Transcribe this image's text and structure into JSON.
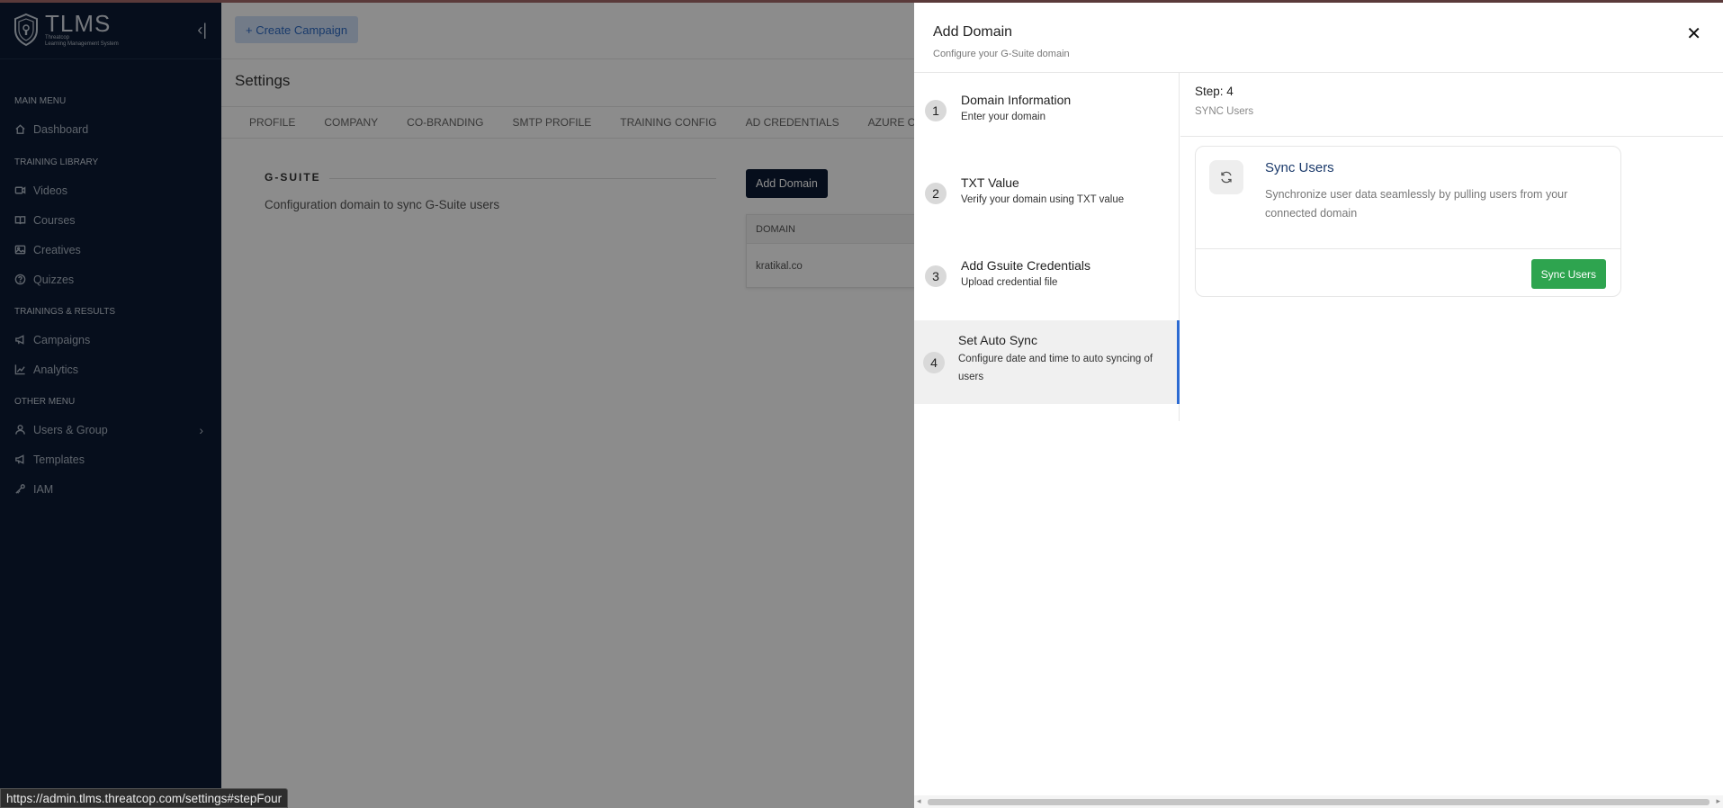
{
  "sidebar": {
    "brand_name": "TLMS",
    "brand_sub_1": "Threatcop",
    "brand_sub_2": "Learning Management System",
    "sections": {
      "main_menu": "MAIN MENU",
      "training_library": "TRAINING LIBRARY",
      "trainings_results": "TRAININGS & RESULTS",
      "other_menu": "OTHER MENU"
    },
    "items": {
      "dashboard": "Dashboard",
      "videos": "Videos",
      "courses": "Courses",
      "creatives": "Creatives",
      "quizzes": "Quizzes",
      "campaigns": "Campaigns",
      "analytics": "Analytics",
      "users_group": "Users & Group",
      "templates": "Templates",
      "iam": "IAM"
    }
  },
  "main": {
    "create_campaign": "+ Create Campaign",
    "page_title": "Settings",
    "tabs": [
      "PROFILE",
      "COMPANY",
      "CO-BRANDING",
      "SMTP PROFILE",
      "TRAINING CONFIG",
      "AD CREDENTIALS",
      "AZURE CR"
    ],
    "gsuite_heading": "G-SUITE",
    "gsuite_desc": "Configuration domain to sync G-Suite users",
    "add_domain_button": "Add Domain",
    "table_header": "DOMAIN",
    "table_rows": [
      "kratikal.co"
    ]
  },
  "drawer": {
    "title": "Add Domain",
    "subtitle": "Configure your G-Suite domain",
    "steps": [
      {
        "num": "1",
        "title": "Domain Information",
        "desc": "Enter your domain"
      },
      {
        "num": "2",
        "title": "TXT Value",
        "desc": "Verify your domain using TXT value"
      },
      {
        "num": "3",
        "title": "Add Gsuite Credentials",
        "desc": "Upload credential file"
      },
      {
        "num": "4",
        "title": "Set Auto Sync",
        "desc": "Configure date and time to auto syncing of users"
      }
    ],
    "active_step": 4,
    "step_label": "Step: 4",
    "step_sub": "SYNC Users",
    "card_title": "Sync Users",
    "card_desc": "Synchronize user data seamlessly by pulling users from your connected domain",
    "sync_button": "Sync Users"
  },
  "status_url": "https://admin.tlms.threatcop.com/settings#stepFour",
  "colors": {
    "sidebar_bg": "#0b1a33",
    "accent_blue": "#2d6bd2",
    "sync_green": "#2ea44f"
  }
}
